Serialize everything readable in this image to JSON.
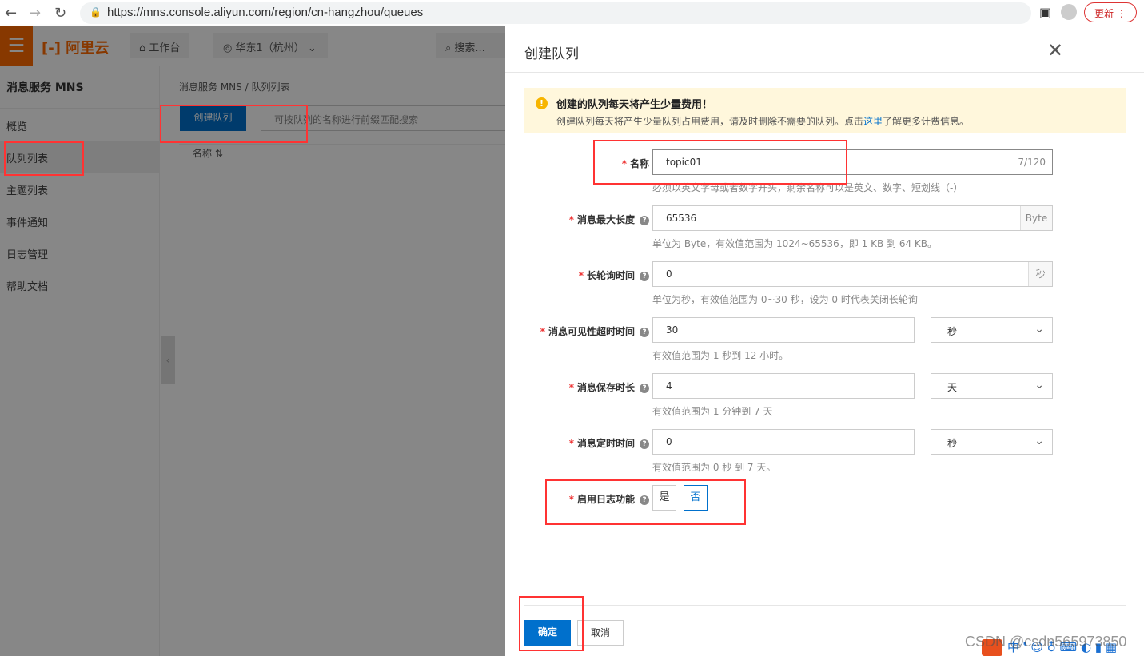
{
  "browser": {
    "url": "https://mns.console.aliyun.com/region/cn-hangzhou/queues",
    "update_label": "更新"
  },
  "console": {
    "logo": "阿里云",
    "workbench": "工作台",
    "region": "华东1（杭州）",
    "search_placeholder": "搜索...",
    "sidebar": {
      "title": "消息服务 MNS",
      "items": [
        {
          "label": "概览"
        },
        {
          "label": "队列列表"
        },
        {
          "label": "主题列表"
        },
        {
          "label": "事件通知"
        },
        {
          "label": "日志管理"
        },
        {
          "label": "帮助文档"
        }
      ]
    },
    "breadcrumb": [
      "消息服务 MNS",
      "/",
      "队列列表"
    ],
    "create_button": "创建队列",
    "search_hint": "可按队列的名称进行前缀匹配搜索",
    "column_name": "名称"
  },
  "drawer": {
    "title": "创建队列",
    "alert": {
      "title": "创建的队列每天将产生少量费用！",
      "text_before": "创建队列每天将产生少量队列占用费用，请及时删除不需要的队列。点击",
      "link": "这里",
      "text_after": "了解更多计费信息。"
    },
    "fields": {
      "name": {
        "label": "名称",
        "value": "topic01",
        "counter": "7/120",
        "help": "必须以英文字母或者数字开头，剩余名称可以是英文、数字、短划线（-）"
      },
      "max_len": {
        "label": "消息最大长度",
        "value": "65536",
        "unit": "Byte",
        "help": "单位为 Byte，有效值范围为 1024~65536，即 1 KB 到 64 KB。"
      },
      "poll": {
        "label": "长轮询时间",
        "value": "0",
        "unit": "秒",
        "help": "单位为秒，有效值范围为 0~30 秒，设为 0 时代表关闭长轮询"
      },
      "visibility": {
        "label": "消息可见性超时时间",
        "value": "30",
        "unit": "秒",
        "help": "有效值范围为 1 秒到 12 小时。"
      },
      "retention": {
        "label": "消息保存时长",
        "value": "4",
        "unit": "天",
        "help": "有效值范围为 1 分钟到 7 天"
      },
      "delay": {
        "label": "消息定时时间",
        "value": "0",
        "unit": "秒",
        "help": "有效值范围为 0 秒 到 7 天。"
      },
      "logging": {
        "label": "启用日志功能",
        "yes": "是",
        "no": "否"
      }
    },
    "ok": "确定",
    "cancel": "取消"
  },
  "watermark": "CSDN @csdn565973850"
}
